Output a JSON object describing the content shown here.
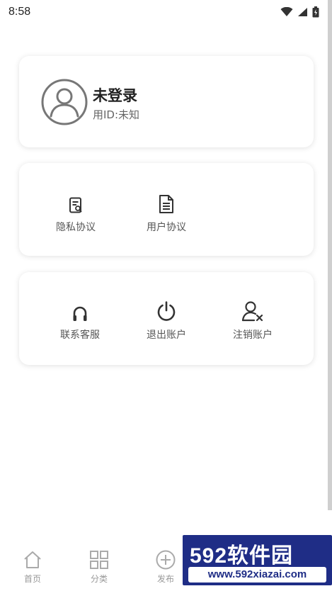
{
  "status_bar": {
    "time": "8:58"
  },
  "profile": {
    "name": "未登录",
    "user_id": "用ID:未知"
  },
  "agreements": [
    {
      "label": "隐私协议",
      "icon": "privacy-document-icon"
    },
    {
      "label": "用户协议",
      "icon": "document-icon"
    }
  ],
  "account_actions": [
    {
      "label": "联系客服",
      "icon": "headset-icon"
    },
    {
      "label": "退出账户",
      "icon": "power-icon"
    },
    {
      "label": "注销账户",
      "icon": "user-remove-icon"
    }
  ],
  "tabbar": [
    {
      "label": "首页",
      "icon": "home-icon"
    },
    {
      "label": "分类",
      "icon": "grid-icon"
    },
    {
      "label": "发布",
      "icon": "plus-circle-icon"
    }
  ],
  "watermark": {
    "brand": "592软件园",
    "url": "www.592xiazai.com"
  }
}
